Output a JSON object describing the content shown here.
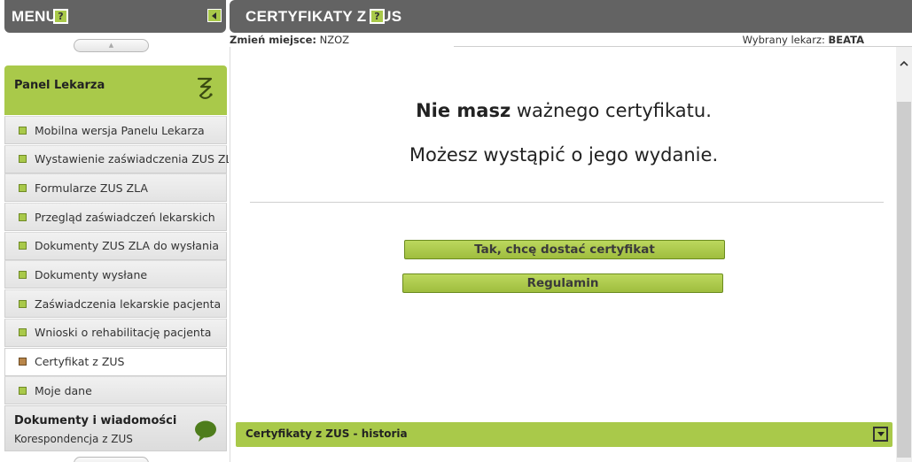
{
  "sidebar": {
    "title": "MENU",
    "help_label": "?",
    "scroll_up_glyph": "▲",
    "panel": {
      "label": "Panel Lekarza"
    },
    "items": [
      {
        "label": "Mobilna wersja Panelu Lekarza",
        "active": false
      },
      {
        "label": "Wystawienie zaświadczenia ZUS ZLA",
        "active": false
      },
      {
        "label": "Formularze ZUS ZLA",
        "active": false
      },
      {
        "label": "Przegląd zaświadczeń lekarskich",
        "active": false
      },
      {
        "label": "Dokumenty ZUS ZLA do wysłania",
        "active": false
      },
      {
        "label": "Dokumenty wysłane",
        "active": false
      },
      {
        "label": "Zaświadczenia lekarskie pacjenta",
        "active": false
      },
      {
        "label": "Wnioski o rehabilitację pacjenta",
        "active": false
      },
      {
        "label": "Certyfikat z ZUS",
        "active": true
      },
      {
        "label": "Moje dane",
        "active": false
      }
    ],
    "docs": {
      "title": "Dokumenty i wiadomości",
      "subtitle": "Korespondencja z ZUS"
    }
  },
  "main": {
    "title": "CERTYFIKATY Z ZUS",
    "help_label": "?",
    "info": {
      "location_label": "Zmień miejsce:",
      "location_value": "NZOZ",
      "doctor_label": "Wybrany lekarz:",
      "doctor_value": "BEATA"
    },
    "message_bold": "Nie masz",
    "message_rest": " ważnego certyfikatu.",
    "message_2": "Możesz wystąpić o jego wydanie.",
    "request_button": "Tak, chcę dostać certyfikat",
    "terms_button": "Regulamin",
    "history_label": "Certyfikaty z ZUS - historia"
  },
  "colors": {
    "accent_green": "#a9c94a",
    "header_gray": "#636363",
    "active_bullet": "#b9864a"
  },
  "icons": {
    "panel_logo": "snake-staff-icon",
    "docs": "speech-bubble-icon",
    "collapse": "triangle-left-icon",
    "history_toggle": "triangle-down-icon",
    "scroll_up": "chevron-up-icon"
  }
}
